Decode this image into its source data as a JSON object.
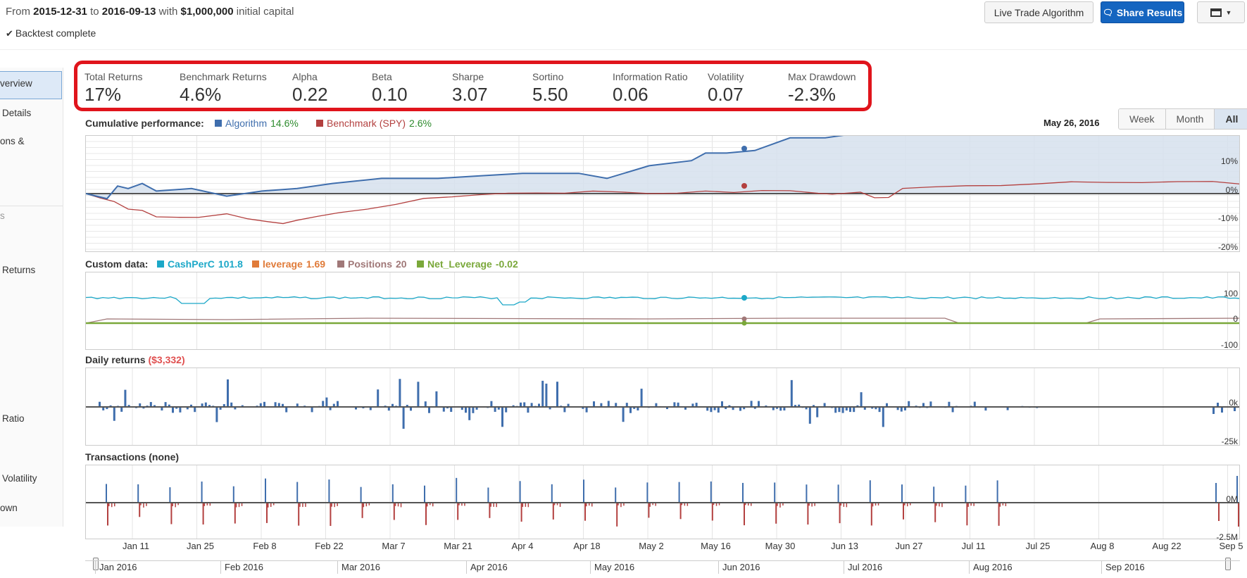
{
  "header": {
    "from_label": "From",
    "start_date": "2015-12-31",
    "to_label": "to",
    "end_date": "2016-09-13",
    "with_label": "with",
    "capital": "$1,000,000",
    "capital_suffix": "initial capital",
    "status": "Backtest complete",
    "live_button": "Live Trade Algorithm",
    "share_button": "Share Results"
  },
  "sidebar": {
    "items": [
      "verview",
      "Details",
      "ons &",
      "s",
      "Returns",
      "Ratio",
      "Volatility",
      "own"
    ]
  },
  "stats": [
    {
      "label": "Total Returns",
      "value": "17%"
    },
    {
      "label": "Benchmark Returns",
      "value": "4.6%"
    },
    {
      "label": "Alpha",
      "value": "0.22"
    },
    {
      "label": "Beta",
      "value": "0.10"
    },
    {
      "label": "Sharpe",
      "value": "3.07"
    },
    {
      "label": "Sortino",
      "value": "5.50"
    },
    {
      "label": "Information Ratio",
      "value": "0.06"
    },
    {
      "label": "Volatility",
      "value": "0.07"
    },
    {
      "label": "Max Drawdown",
      "value": "-2.3%"
    }
  ],
  "cumulative": {
    "title": "Cumulative performance:",
    "algo_name": "Algorithm",
    "algo_value": "14.6%",
    "bench_name": "Benchmark (SPY)",
    "bench_value": "2.6%",
    "date": "May 26, 2016",
    "range_buttons": [
      "Week",
      "Month",
      "All"
    ],
    "y_ticks": [
      "10%",
      "0%",
      "-10%",
      "-20%"
    ]
  },
  "custom": {
    "title": "Custom data:",
    "series": [
      {
        "name": "CashPerC",
        "value": "101.8",
        "color": "#1ca8c8"
      },
      {
        "name": "leverage",
        "value": "1.69",
        "color": "#e07b39"
      },
      {
        "name": "Positions",
        "value": "20",
        "color": "#a07878"
      },
      {
        "name": "Net_Leverage",
        "value": "-0.02",
        "color": "#7aa83a"
      }
    ],
    "y_ticks": [
      "100",
      "0",
      "-100"
    ]
  },
  "daily": {
    "title": "Daily returns",
    "value": "($3,332)",
    "y_ticks": [
      "0k",
      "-25k"
    ]
  },
  "transactions": {
    "title": "Transactions",
    "value": "(none)",
    "y_ticks": [
      "0M",
      "-2.5M"
    ]
  },
  "x_axis": [
    "Jan 11",
    "Jan 25",
    "Feb 8",
    "Feb 22",
    "Mar 7",
    "Mar 21",
    "Apr 4",
    "Apr 18",
    "May 2",
    "May 16",
    "May 30",
    "Jun 13",
    "Jun 27",
    "Jul 11",
    "Jul 25",
    "Aug 8",
    "Aug 22",
    "Sep 5"
  ],
  "navigator": [
    "Jan 2016",
    "Feb 2016",
    "Mar 2016",
    "Apr 2016",
    "May 2016",
    "Jun 2016",
    "Jul 2016",
    "Aug 2016",
    "Sep 2016"
  ],
  "colors": {
    "algorithm": "#3f6ead",
    "benchmark": "#b3403f",
    "accent_button": "#1565c0",
    "highlight_box": "#e0141c"
  }
}
